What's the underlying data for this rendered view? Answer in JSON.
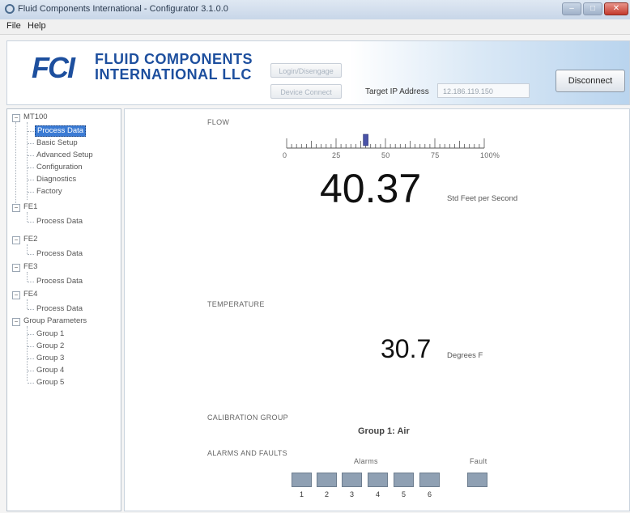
{
  "window": {
    "title": "Fluid Components International - Configurator 3.1.0.0"
  },
  "menu": {
    "items": [
      "File",
      "Help"
    ]
  },
  "header": {
    "logo_mark": "FCI",
    "logo_line1": "FLUID COMPONENTS",
    "logo_line2": "INTERNATIONAL LLC",
    "button1": "Login/Disengage",
    "button2": "Device Connect",
    "ip_label": "Target IP Address",
    "ip_value": "12.186.119.150",
    "disconnect": "Disconnect"
  },
  "tree": {
    "mt100": "MT100",
    "mt100_children": [
      "Process Data",
      "Basic Setup",
      "Advanced Setup",
      "Configuration",
      "Diagnostics",
      "Factory"
    ],
    "fe1": "FE1",
    "fe1_child": "Process Data",
    "fe2": "FE2",
    "fe2_child": "Process Data",
    "fe3": "FE3",
    "fe3_child": "Process Data",
    "fe4": "FE4",
    "fe4_child": "Process Data",
    "group_params": "Group Parameters",
    "groups": [
      "Group 1",
      "Group 2",
      "Group 3",
      "Group 4",
      "Group 5"
    ]
  },
  "flow": {
    "label": "FLOW",
    "value": "40.37",
    "unit": "Std Feet per Second",
    "gauge_percent": 40,
    "ticks": [
      "0",
      "25",
      "50",
      "75",
      "100%"
    ]
  },
  "temperature": {
    "label": "TEMPERATURE",
    "value": "30.7",
    "unit": "Degrees F"
  },
  "calibration": {
    "label": "CALIBRATION GROUP",
    "value": "Group 1: Air"
  },
  "alarms": {
    "label": "ALARMS AND FAULTS",
    "alarms_title": "Alarms",
    "fault_title": "Fault",
    "numbers": [
      "1",
      "2",
      "3",
      "4",
      "5",
      "6"
    ],
    "color_off": "#8fa0b3"
  }
}
